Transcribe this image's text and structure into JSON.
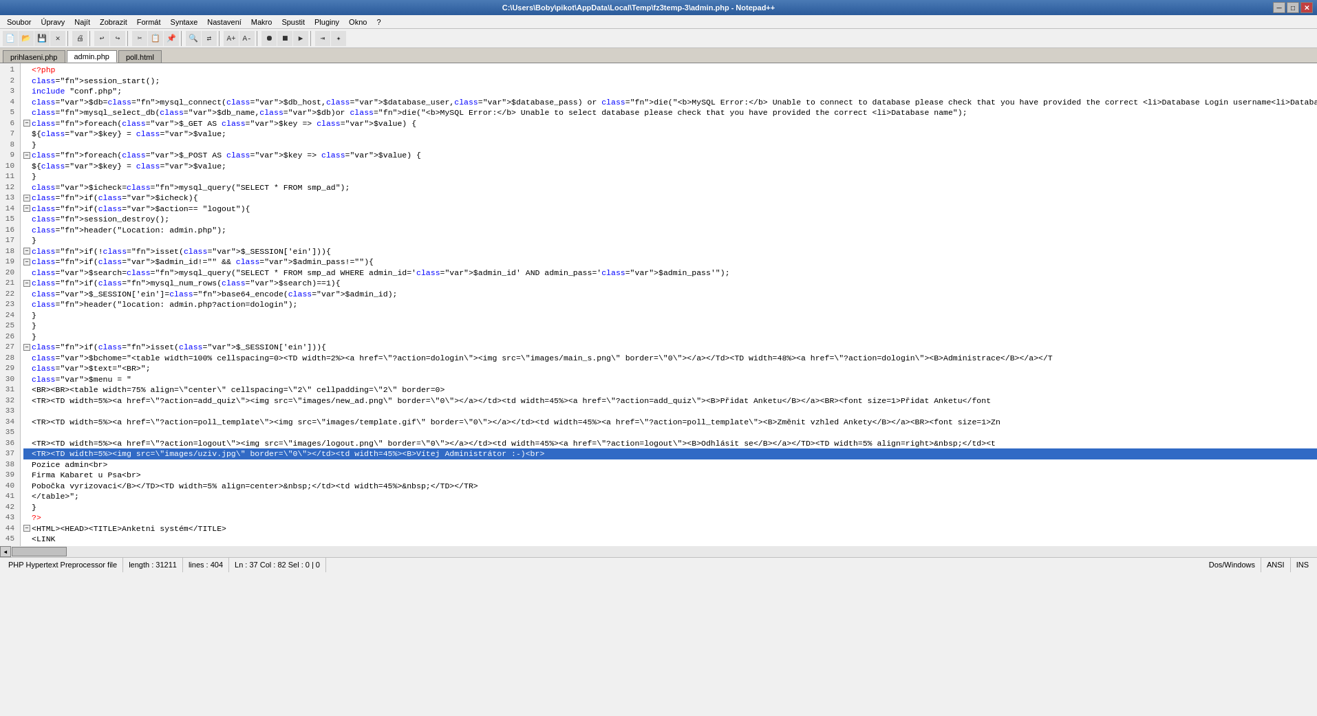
{
  "titleBar": {
    "title": "C:\\Users\\Boby\\pikot\\AppData\\Local\\Temp\\fz3temp-3\\admin.php - Notepad++"
  },
  "menuBar": {
    "items": [
      "Soubor",
      "Úpravy",
      "Najít",
      "Zobrazit",
      "Formát",
      "Syntaxe",
      "Nastavení",
      "Makro",
      "Spustit",
      "Pluginy",
      "Okno",
      "?"
    ]
  },
  "tabs": [
    {
      "label": "prihlaseni.php",
      "active": false
    },
    {
      "label": "admin.php",
      "active": true
    },
    {
      "label": "poll.html",
      "active": false
    }
  ],
  "statusBar": {
    "fileType": "PHP Hypertext Preprocessor file",
    "length": "length : 31211",
    "lines": "lines : 404",
    "position": "Ln : 37   Col : 82   Sel : 0 | 0",
    "lineEnding": "Dos/Windows",
    "encoding": "ANSI",
    "insertMode": "INS"
  },
  "code": {
    "lines": [
      {
        "num": 1,
        "fold": "none",
        "content": "<?php",
        "highlight": false
      },
      {
        "num": 2,
        "fold": "none",
        "content": "session_start();",
        "highlight": false
      },
      {
        "num": 3,
        "fold": "none",
        "content": "include \"conf.php\";",
        "highlight": false
      },
      {
        "num": 4,
        "fold": "none",
        "content": "$db=mysql_connect($db_host,$database_user,$database_pass) or die(\"<b>MySQL Error:</b> Unable to connect to database please check that you have provided the correct <li>Database Login username<li>Database",
        "highlight": false
      },
      {
        "num": 5,
        "fold": "none",
        "content": "mysql_select_db($db_name,$db)or die(\"<b>MySQL Error:</b> Unable to select database please check that you have provided the correct <li>Database name\");",
        "highlight": false
      },
      {
        "num": 6,
        "fold": "open",
        "content": "foreach($_GET AS $key => $value) {",
        "highlight": false
      },
      {
        "num": 7,
        "fold": "none",
        "content": "  ${$key} = $value;",
        "highlight": false
      },
      {
        "num": 8,
        "fold": "none",
        "content": "}",
        "highlight": false
      },
      {
        "num": 9,
        "fold": "open",
        "content": "foreach($_POST AS $key => $value) {",
        "highlight": false
      },
      {
        "num": 10,
        "fold": "none",
        "content": "  ${$key} = $value;",
        "highlight": false
      },
      {
        "num": 11,
        "fold": "none",
        "content": "}",
        "highlight": false
      },
      {
        "num": 12,
        "fold": "none",
        "content": "$icheck=mysql_query(\"SELECT * FROM smp_ad\");",
        "highlight": false
      },
      {
        "num": 13,
        "fold": "open",
        "content": "if($icheck){",
        "highlight": false
      },
      {
        "num": 14,
        "fold": "open",
        "content": "if($action== \"logout\"){",
        "highlight": false
      },
      {
        "num": 15,
        "fold": "none",
        "content": "  session_destroy();",
        "highlight": false
      },
      {
        "num": 16,
        "fold": "none",
        "content": "  header(\"Location: admin.php\");",
        "highlight": false
      },
      {
        "num": 17,
        "fold": "none",
        "content": "}",
        "highlight": false
      },
      {
        "num": 18,
        "fold": "open",
        "content": "if(!isset($_SESSION['ein'])){",
        "highlight": false
      },
      {
        "num": 19,
        "fold": "open",
        "content": "if($admin_id!=\"\" && $admin_pass!=\"\"){",
        "highlight": false
      },
      {
        "num": 20,
        "fold": "none",
        "content": "  $search=mysql_query(\"SELECT * FROM smp_ad WHERE admin_id='$admin_id' AND admin_pass='$admin_pass'\");",
        "highlight": false
      },
      {
        "num": 21,
        "fold": "open",
        "content": "if(mysql_num_rows($search)==1){",
        "highlight": false
      },
      {
        "num": 22,
        "fold": "none",
        "content": "  $_SESSION['ein']=base64_encode($admin_id);",
        "highlight": false
      },
      {
        "num": 23,
        "fold": "none",
        "content": "  header(\"location: admin.php?action=dologin\");",
        "highlight": false
      },
      {
        "num": 24,
        "fold": "none",
        "content": "}",
        "highlight": false
      },
      {
        "num": 25,
        "fold": "none",
        "content": "}",
        "highlight": false
      },
      {
        "num": 26,
        "fold": "none",
        "content": "}",
        "highlight": false
      },
      {
        "num": 27,
        "fold": "open",
        "content": "if(isset($_SESSION['ein'])){",
        "highlight": false
      },
      {
        "num": 28,
        "fold": "none",
        "content": "  $bchome=\"<table width=100% cellspacing=0><TD width=2%><a href=\\\"?action=dologin\\\"><img src=\\\"images/main_s.png\\\" border=\\\"0\\\"></a></Td><TD width=48%><a href=\\\"?action=dologin\\\"><B>Administrace</B></a></T",
        "highlight": false
      },
      {
        "num": 29,
        "fold": "none",
        "content": "  $text=\"<BR>\";",
        "highlight": false
      },
      {
        "num": 30,
        "fold": "none",
        "content": "  $menu = \"",
        "highlight": false
      },
      {
        "num": 31,
        "fold": "none",
        "content": "  <BR><BR><table width=75% align=\\\"center\\\" cellspacing=\\\"2\\\" cellpadding=\\\"2\\\" border=0>",
        "highlight": false
      },
      {
        "num": 32,
        "fold": "none",
        "content": "  <TR><TD width=5%><a href=\\\"?action=add_quiz\\\"><img src=\\\"images/new_ad.png\\\" border=\\\"0\\\"></a></td><td width=45%><a href=\\\"?action=add_quiz\\\"><B>Přidat Anketu</B></a><BR><font size=1>Přidat Anketu</font",
        "highlight": false
      },
      {
        "num": 33,
        "fold": "none",
        "content": "",
        "highlight": false
      },
      {
        "num": 34,
        "fold": "none",
        "content": "  <TR><TD width=5%><a href=\\\"?action=poll_template\\\"><img src=\\\"images/template.gif\\\" border=\\\"0\\\"></a></td><td width=45%><a href=\\\"?action=poll_template\\\"><B>Změnit vzhled Ankety</B></a><BR><font size=1>Zn",
        "highlight": false
      },
      {
        "num": 35,
        "fold": "none",
        "content": "",
        "highlight": false
      },
      {
        "num": 36,
        "fold": "none",
        "content": "  <TR><TD width=5%><a href=\\\"?action=logout\\\"><img src=\\\"images/logout.png\\\" border=\\\"0\\\"></a></td><td width=45%><a href=\\\"?action=logout\\\"><B>Odhlásit se</B></a></TD><TD width=5% align=right>&nbsp;</td><t",
        "highlight": false
      },
      {
        "num": 37,
        "fold": "none",
        "content": "  <TR><TD width=5%><img src=\\\"images/uziv.jpg\\\" border=\\\"0\\\"></td><td width=45%><B>Vítej Administrátor :-)<br>",
        "highlight": true
      },
      {
        "num": 38,
        "fold": "none",
        "content": "  Pozice admin<br>",
        "highlight": false
      },
      {
        "num": 39,
        "fold": "none",
        "content": "  Firma Kabaret u Psa<br>",
        "highlight": false
      },
      {
        "num": 40,
        "fold": "none",
        "content": "  Pobočka vyrizovaci</B></TD><TD width=5% align=center>&nbsp;</td><td width=45%>&nbsp;</TD></TR>",
        "highlight": false
      },
      {
        "num": 41,
        "fold": "none",
        "content": "  </table>\";",
        "highlight": false
      },
      {
        "num": 42,
        "fold": "none",
        "content": "}",
        "highlight": false
      },
      {
        "num": 43,
        "fold": "none",
        "content": "?>",
        "highlight": false
      },
      {
        "num": 44,
        "fold": "open",
        "content": "<HTML><HEAD><TITLE>Anketni systém</TITLE>",
        "highlight": false
      },
      {
        "num": 45,
        "fold": "none",
        "content": "  <LINK",
        "highlight": false
      }
    ]
  }
}
